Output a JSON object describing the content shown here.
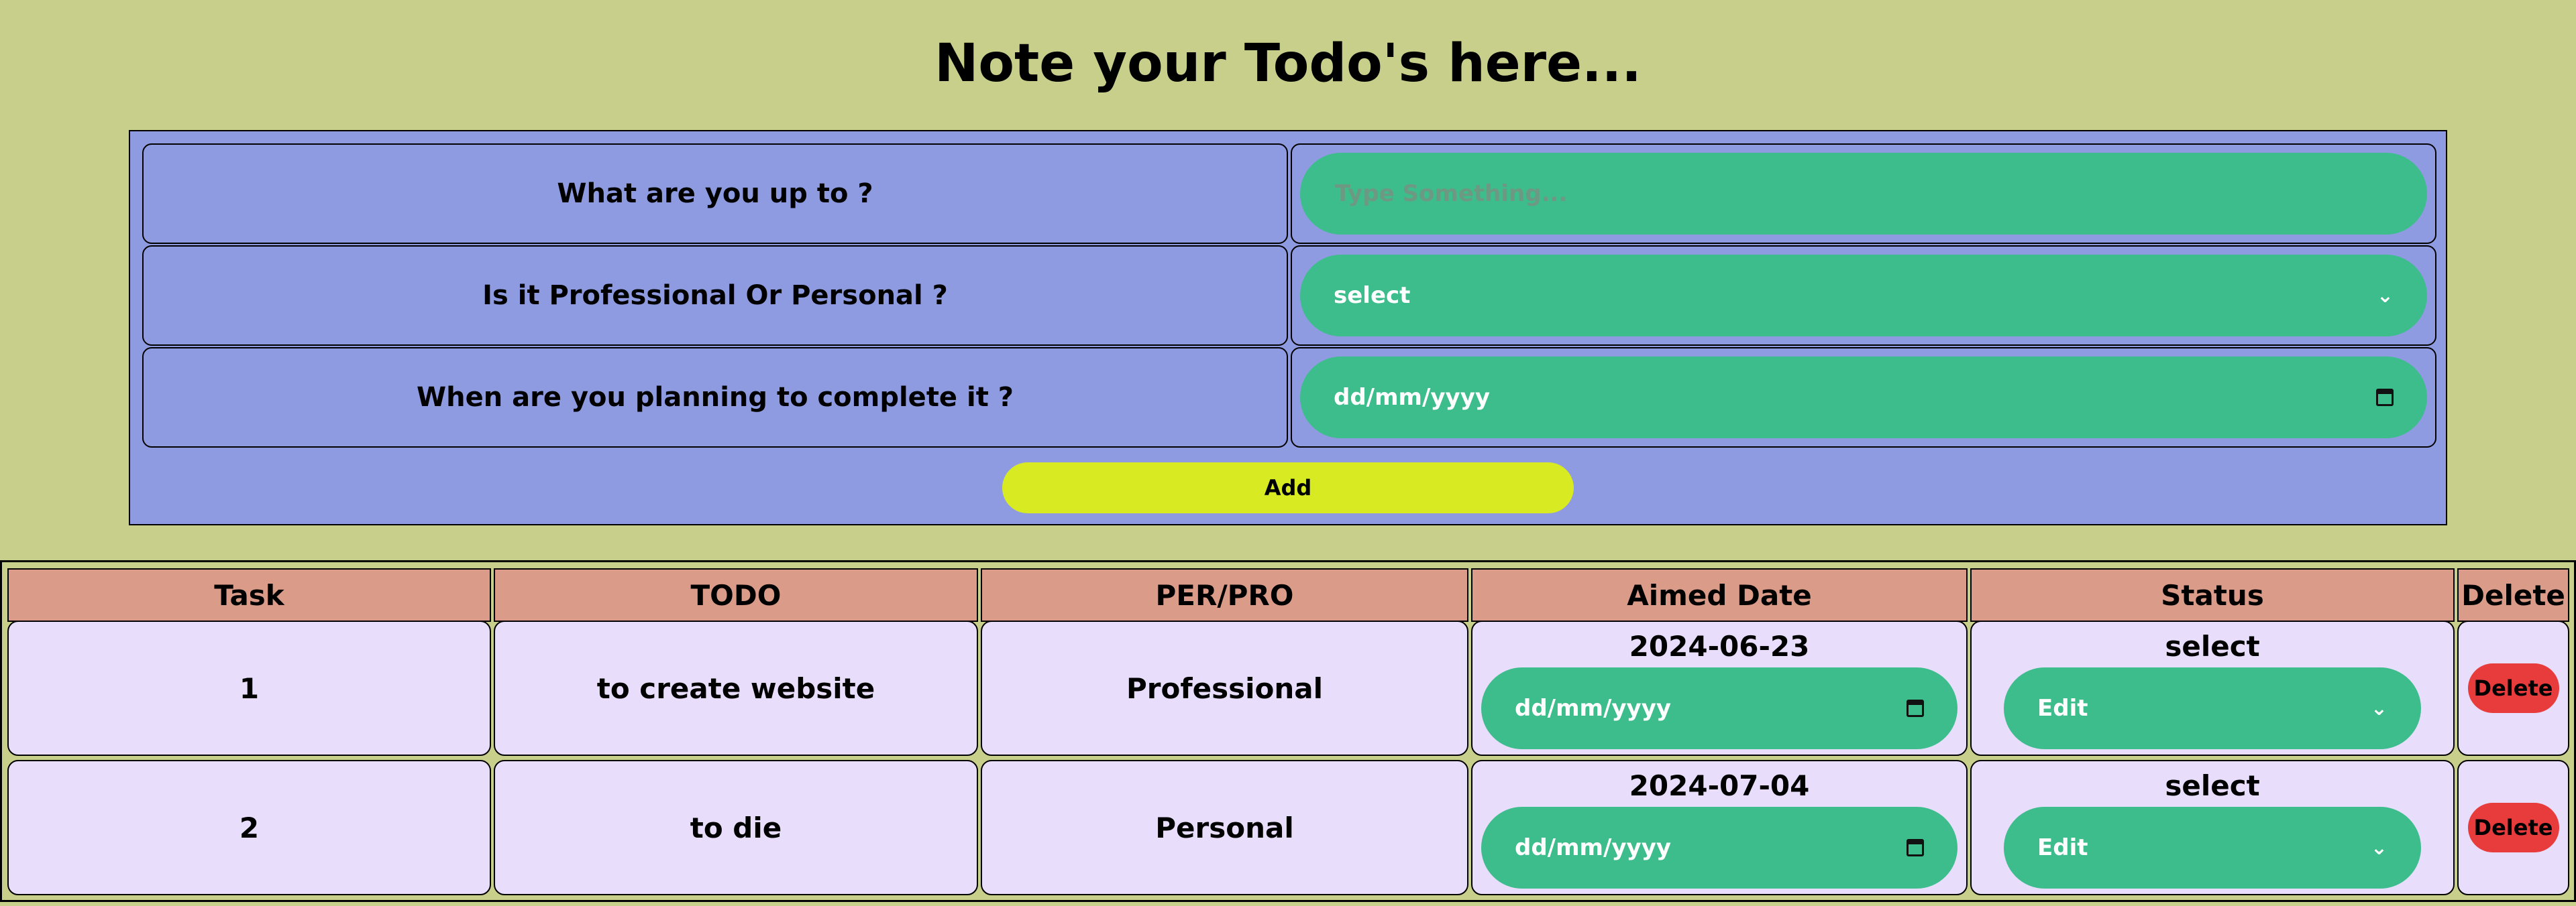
{
  "title": "Note your Todo's here...",
  "form": {
    "task_label": "What are you up to ?",
    "task_placeholder": "Type Something...",
    "type_label": "Is it Professional Or Personal ?",
    "type_value": "select",
    "date_label": "When are you planning to complete it ?",
    "date_placeholder": "dd/mm/yyyy",
    "add_label": "Add"
  },
  "table": {
    "headers": [
      "Task",
      "TODO",
      "PER/PRO",
      "Aimed Date",
      "Status",
      "Delete"
    ],
    "rows": [
      {
        "task": "1",
        "todo": "to create website",
        "type": "Professional",
        "aimed_date": "2024-06-23",
        "date_input": "dd/mm/yyyy",
        "status": "select",
        "status_select": "Edit",
        "delete": "Delete"
      },
      {
        "task": "2",
        "todo": "to die",
        "type": "Personal",
        "aimed_date": "2024-07-04",
        "date_input": "dd/mm/yyyy",
        "status": "select",
        "status_select": "Edit",
        "delete": "Delete"
      }
    ]
  },
  "icons": {
    "dropdown": "chevron-down-icon",
    "date": "calendar-icon"
  },
  "colors": {
    "background": "#c8cf8a",
    "form_panel": "#8e9be0",
    "input_pill": "#3dbc8c",
    "add_button": "#d8ea22",
    "table_header": "#db9b89",
    "table_cell": "#e8ddfa",
    "delete_button": "#e83b3b"
  }
}
